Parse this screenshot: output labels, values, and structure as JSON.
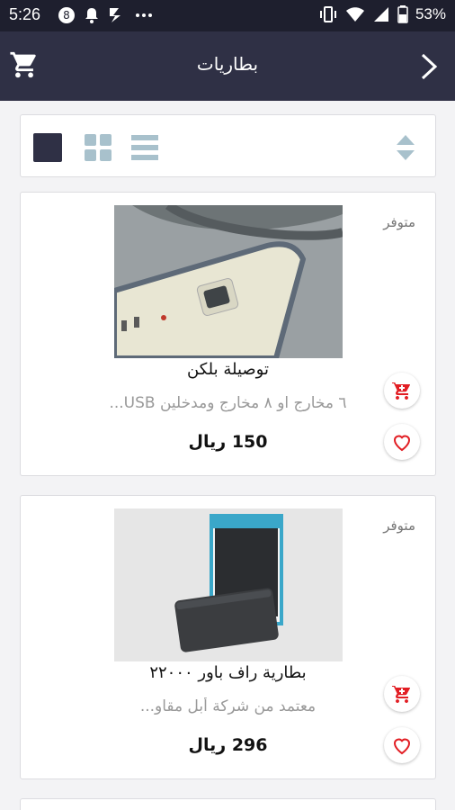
{
  "status_bar": {
    "time": "5:26",
    "battery": "53%",
    "left_icons": [
      "circle-8-icon",
      "bell-icon",
      "sim-signal-icon",
      "more-dots-icon"
    ],
    "right_icons": [
      "vibrate-icon",
      "wifi-icon",
      "cell-signal-icon",
      "battery-icon"
    ]
  },
  "app_bar": {
    "title": "بطاريات",
    "cart_icon": "cart-icon",
    "back_icon": "chevron-right-icon",
    "background": "#2f3045"
  },
  "toolbar": {
    "views": [
      "single-view-icon",
      "grid-view-icon",
      "list-view-icon"
    ],
    "active_view": "single",
    "sort_icon": "sort-icon"
  },
  "products": [
    {
      "stock": "متوفر",
      "name": "توصيلة بلكن",
      "description": "٦ مخارج او ٨ مخارج ومدخلين USB...",
      "price": "150 ريال",
      "image": "power-strip"
    },
    {
      "stock": "متوفر",
      "name": "بطارية راف باور ٢٢٠٠٠",
      "description": "معتمد من شركة أبل  مقاو...",
      "price": "296 ريال",
      "image": "power-bank"
    }
  ],
  "colors": {
    "accent": "#2f3045",
    "cart_red": "#e21e24",
    "heart_red": "#e21e24"
  }
}
